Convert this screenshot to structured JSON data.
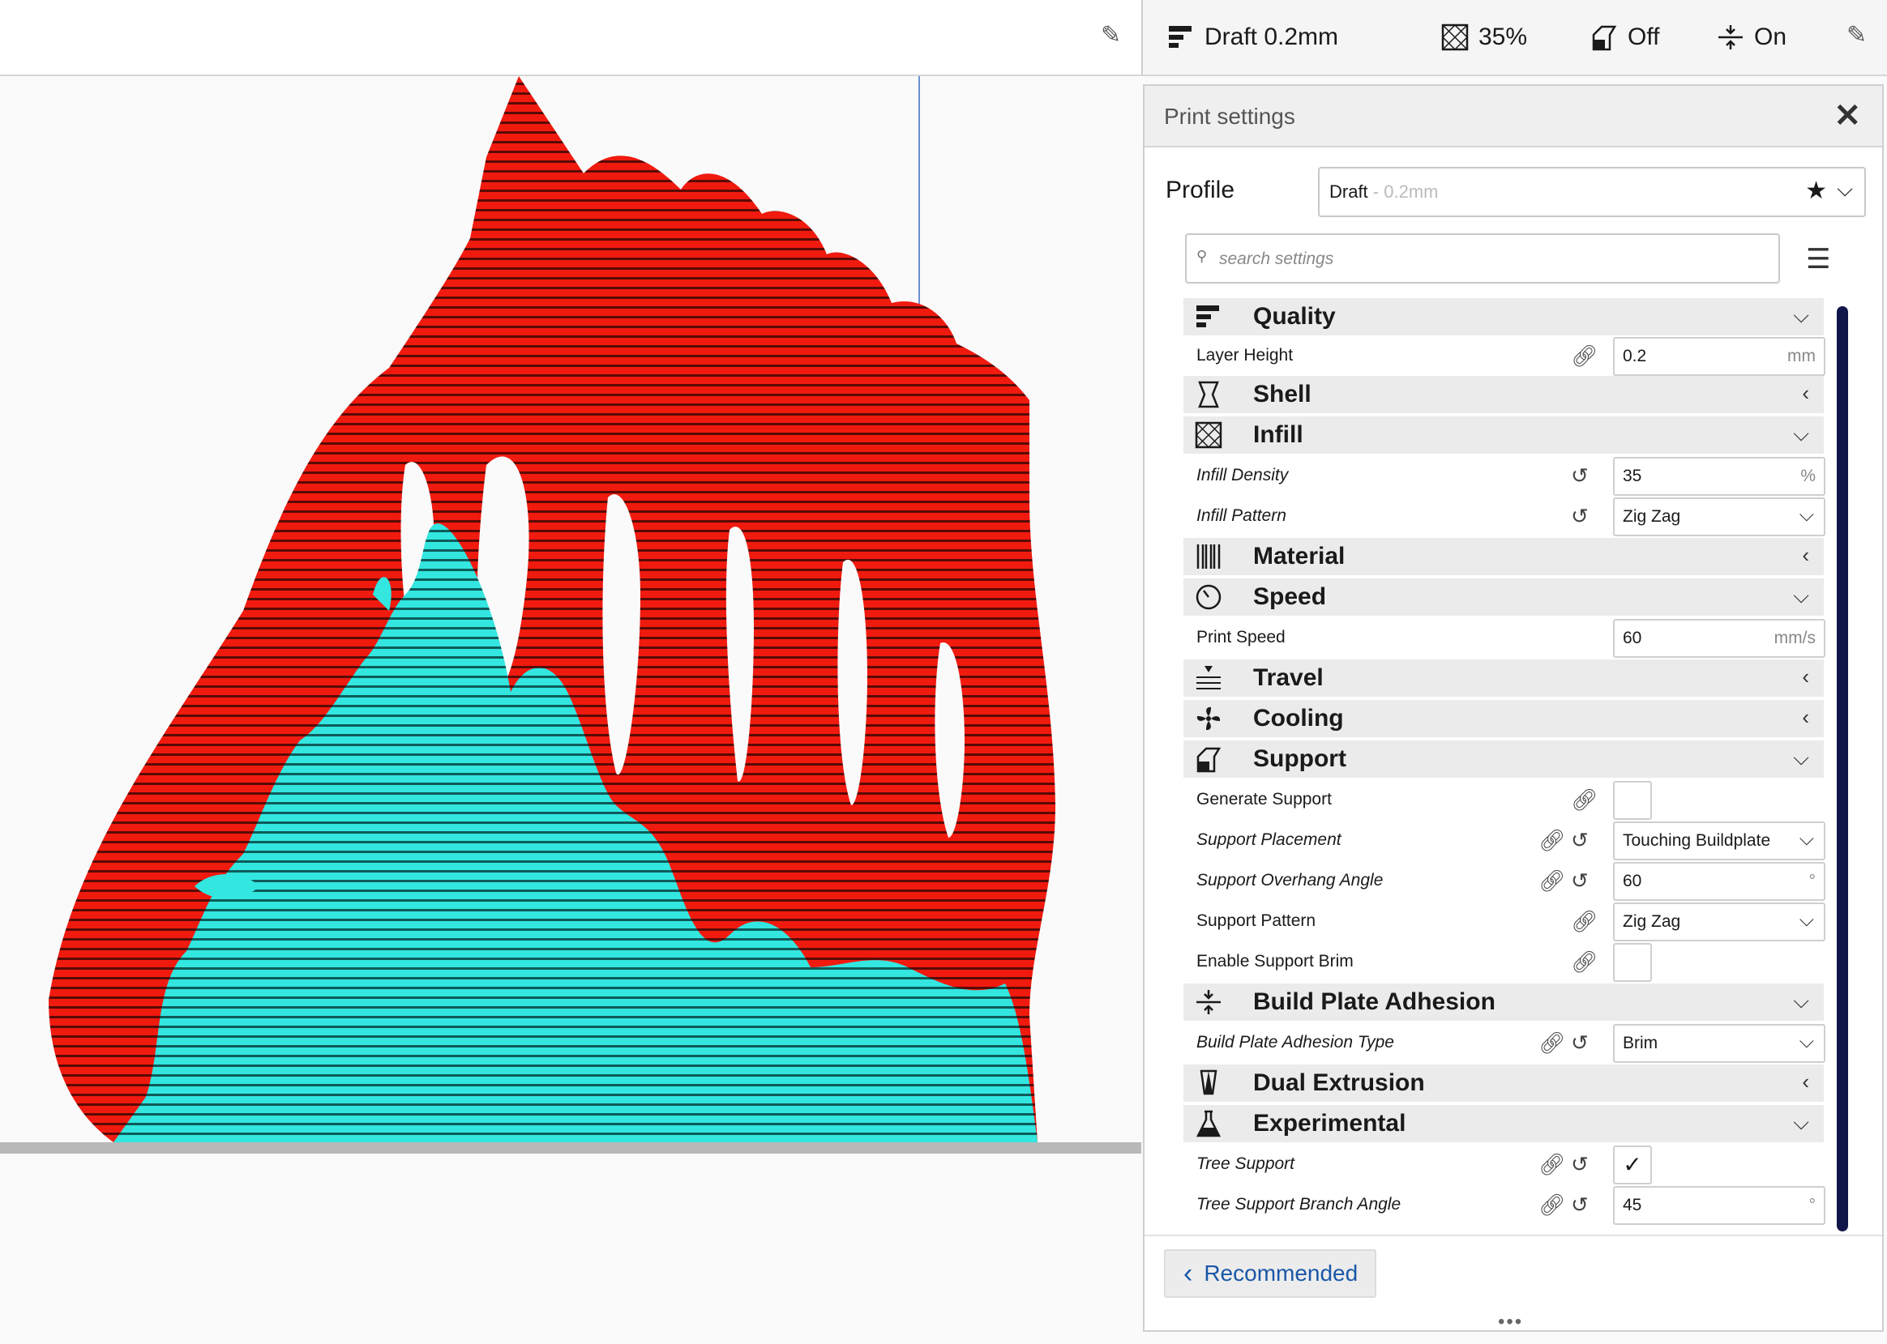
{
  "header": {
    "profile": "Draft 0.2mm",
    "infill": "35%",
    "support": "Off",
    "adhesion": "On",
    "icons": [
      "quality-icon",
      "infill-icon",
      "support-icon",
      "adhesion-icon",
      "pencil-icon"
    ]
  },
  "panel": {
    "title": "Print settings",
    "profile_label": "Profile",
    "profile_name": "Draft",
    "profile_suffix": " - 0.2mm",
    "search_placeholder": "search settings",
    "recommended_label": "Recommended",
    "dots": "•••"
  },
  "categories": {
    "quality": "Quality",
    "shell": "Shell",
    "infill": "Infill",
    "material": "Material",
    "speed": "Speed",
    "travel": "Travel",
    "cooling": "Cooling",
    "support": "Support",
    "adhesion": "Build Plate Adhesion",
    "dual": "Dual Extrusion",
    "experimental": "Experimental"
  },
  "settings": {
    "layer_height": {
      "label": "Layer Height",
      "value": "0.2",
      "unit": "mm"
    },
    "infill_density": {
      "label": "Infill Density",
      "value": "35",
      "unit": "%"
    },
    "infill_pattern": {
      "label": "Infill Pattern",
      "value": "Zig Zag"
    },
    "print_speed": {
      "label": "Print Speed",
      "value": "60",
      "unit": "mm/s"
    },
    "generate_support": {
      "label": "Generate Support",
      "checked": false
    },
    "support_placement": {
      "label": "Support Placement",
      "value": "Touching Buildplate"
    },
    "support_overhang": {
      "label": "Support Overhang Angle",
      "value": "60",
      "unit": "°"
    },
    "support_pattern": {
      "label": "Support Pattern",
      "value": "Zig Zag"
    },
    "support_brim": {
      "label": "Enable Support Brim",
      "checked": false
    },
    "adhesion_type": {
      "label": "Build Plate Adhesion Type",
      "value": "Brim"
    },
    "tree_support": {
      "label": "Tree Support",
      "checked": true,
      "mark": "✓"
    },
    "tree_branch_angle": {
      "label": "Tree Support Branch Angle",
      "value": "45",
      "unit": "°"
    }
  },
  "colors": {
    "model": "#f01a0f",
    "support": "#33e6e0",
    "accent": "#1a57a8",
    "scrollbar": "#101648"
  }
}
